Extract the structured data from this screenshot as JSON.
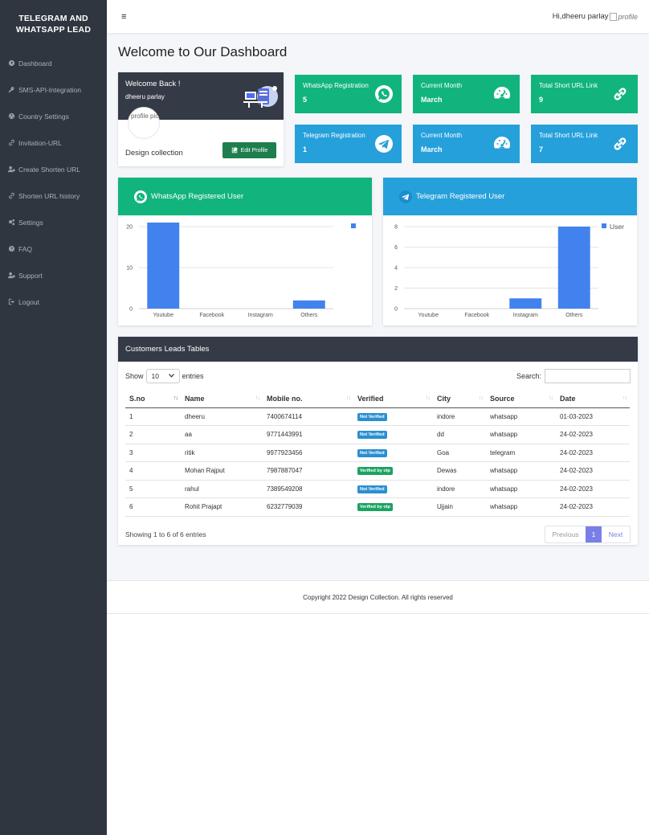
{
  "brand": {
    "line1": "TELEGRAM AND",
    "line2": "WHATSAPP LEAD"
  },
  "sidebar": {
    "items": [
      {
        "label": "Dashboard",
        "icon": "dashboard-icon"
      },
      {
        "label": "SMS-API-Integration",
        "icon": "key-icon"
      },
      {
        "label": "Country Settings",
        "icon": "globe-icon"
      },
      {
        "label": "Invitation-URL",
        "icon": "link-icon"
      },
      {
        "label": "Create Shorten URL",
        "icon": "user-cog-icon"
      },
      {
        "label": "Shorten URL history",
        "icon": "link-icon"
      },
      {
        "label": "Settings",
        "icon": "gears-icon"
      },
      {
        "label": "FAQ",
        "icon": "question-icon"
      },
      {
        "label": "Support",
        "icon": "user-cog-icon"
      },
      {
        "label": "Logout",
        "icon": "logout-icon"
      }
    ]
  },
  "topbar": {
    "menu_icon": "≡",
    "greeting": "Hi,dheeru parlay",
    "profile_alt": "profile"
  },
  "page": {
    "title": "Welcome to Our Dashboard"
  },
  "profile_card": {
    "welcome": "Welcome Back !",
    "name": "dheeru parlay",
    "avatar_alt": "profile pic",
    "label": "Design collection",
    "edit_button": "Edit Profile"
  },
  "stats": [
    {
      "label": "WhatsApp Registration",
      "value": "5",
      "icon": "whatsapp-icon",
      "color": "#12b47e"
    },
    {
      "label": "Current Month",
      "value": "March",
      "icon": "speedometer-icon",
      "color": "#12b47e"
    },
    {
      "label": "Total Short URL Link",
      "value": "9",
      "icon": "link-icon",
      "color": "#12b47e"
    },
    {
      "label": "Telegram Registration",
      "value": "1",
      "icon": "telegram-icon",
      "color": "#26a0da"
    },
    {
      "label": "Current Month",
      "value": "March",
      "icon": "speedometer-icon",
      "color": "#26a0da"
    },
    {
      "label": "Total Short URL Link",
      "value": "7",
      "icon": "link-icon",
      "color": "#26a0da"
    }
  ],
  "charts": {
    "whatsapp_title": "WhatsApp Registered User",
    "telegram_title": "Telegram Registered User"
  },
  "chart_data": [
    {
      "type": "bar",
      "title": "WhatsApp Registered User",
      "categories": [
        "Youtube",
        "Facebook",
        "Instagram",
        "Others"
      ],
      "series": [
        {
          "values": [
            21,
            0,
            0,
            2
          ]
        }
      ],
      "ylim": [
        0,
        20
      ],
      "yticks": [
        0,
        10,
        20
      ],
      "legend": "top-right",
      "bar_color": "#4182ee",
      "grid": true
    },
    {
      "type": "bar",
      "title": "Telegram Registered User",
      "categories": [
        "Youtube",
        "Facebook",
        "Instagram",
        "Others"
      ],
      "series": [
        {
          "name": "User",
          "values": [
            0,
            0,
            1,
            8
          ]
        }
      ],
      "ylim": [
        0,
        8
      ],
      "yticks": [
        0,
        2,
        4,
        6,
        8
      ],
      "legend": "top-right",
      "bar_color": "#4182ee",
      "grid": true
    }
  ],
  "table": {
    "title": "Customers Leads Tables",
    "show_label": "Show",
    "entries_value": "10",
    "entries_label": "entries",
    "search_label": "Search:",
    "columns": [
      "S.no",
      "Name",
      "Mobile no.",
      "Verified",
      "City",
      "Source",
      "Date"
    ],
    "first_col_sort": "↑↓",
    "rows": [
      {
        "sno": "1",
        "name": "dheeru",
        "mobile": "7400674114",
        "verified": "Not Verified",
        "city": "indore",
        "source": "whatsapp",
        "date": "01-03-2023"
      },
      {
        "sno": "2",
        "name": "aa",
        "mobile": "9771443991",
        "verified": "Not Verified",
        "city": "dd",
        "source": "whatsapp",
        "date": "24-02-2023"
      },
      {
        "sno": "3",
        "name": "ritik",
        "mobile": "9977923456",
        "verified": "Not Verified",
        "city": "Goa",
        "source": "telegram",
        "date": "24-02-2023"
      },
      {
        "sno": "4",
        "name": "Mohan Rajput",
        "mobile": "7987887047",
        "verified": "Verified by otp",
        "city": "Dewas",
        "source": "whatsapp",
        "date": "24-02-2023"
      },
      {
        "sno": "5",
        "name": "rahul",
        "mobile": "7389549208",
        "verified": "Not Verified",
        "city": "indore",
        "source": "whatsapp",
        "date": "24-02-2023"
      },
      {
        "sno": "6",
        "name": "Rohit Prajapt",
        "mobile": "6232779039",
        "verified": "Verified by otp",
        "city": "Ujjain",
        "source": "whatsapp",
        "date": "24-02-2023"
      }
    ],
    "info": "Showing 1 to 6 of 6 entries",
    "pager": {
      "prev": "Previous",
      "page": "1",
      "next": "Next"
    }
  },
  "footer": {
    "text": "Copyright 2022 Design Collection. All rights reserved"
  }
}
